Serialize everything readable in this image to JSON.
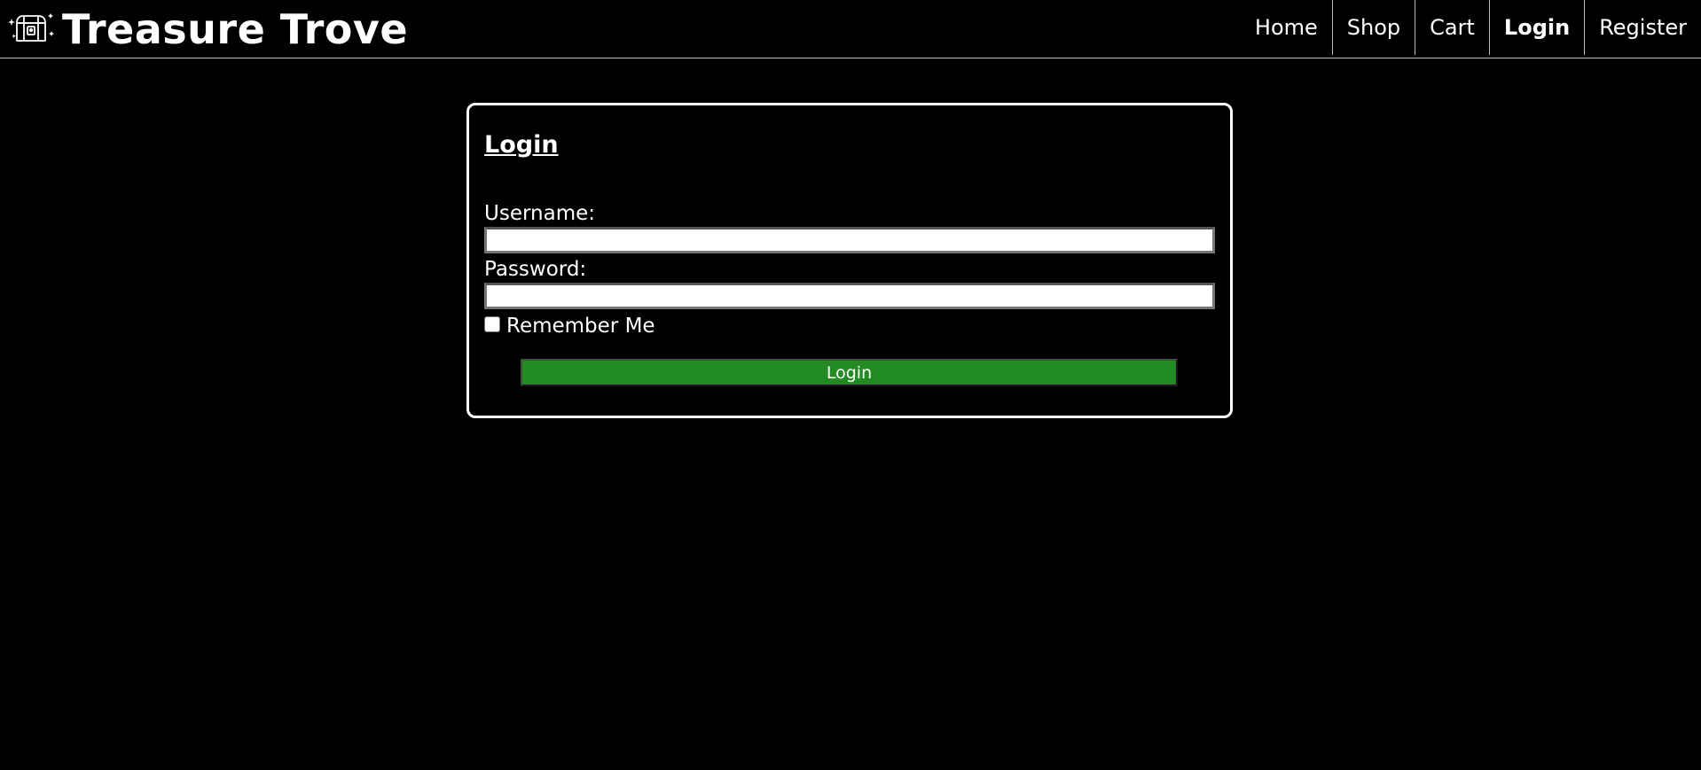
{
  "header": {
    "brand_title": "Treasure Trove",
    "brand_icon": "treasure-chest-icon",
    "nav": [
      {
        "label": "Home",
        "active": false
      },
      {
        "label": "Shop",
        "active": false
      },
      {
        "label": "Cart",
        "active": false
      },
      {
        "label": "Login",
        "active": true
      },
      {
        "label": "Register",
        "active": false
      }
    ]
  },
  "login_form": {
    "title": "Login",
    "username_label": "Username:",
    "username_value": "",
    "password_label": "Password:",
    "password_value": "",
    "remember_label": "Remember Me",
    "remember_checked": false,
    "submit_label": "Login"
  },
  "colors": {
    "background": "#000000",
    "text": "#ffffff",
    "button": "#228b22",
    "border": "#ffffff"
  }
}
